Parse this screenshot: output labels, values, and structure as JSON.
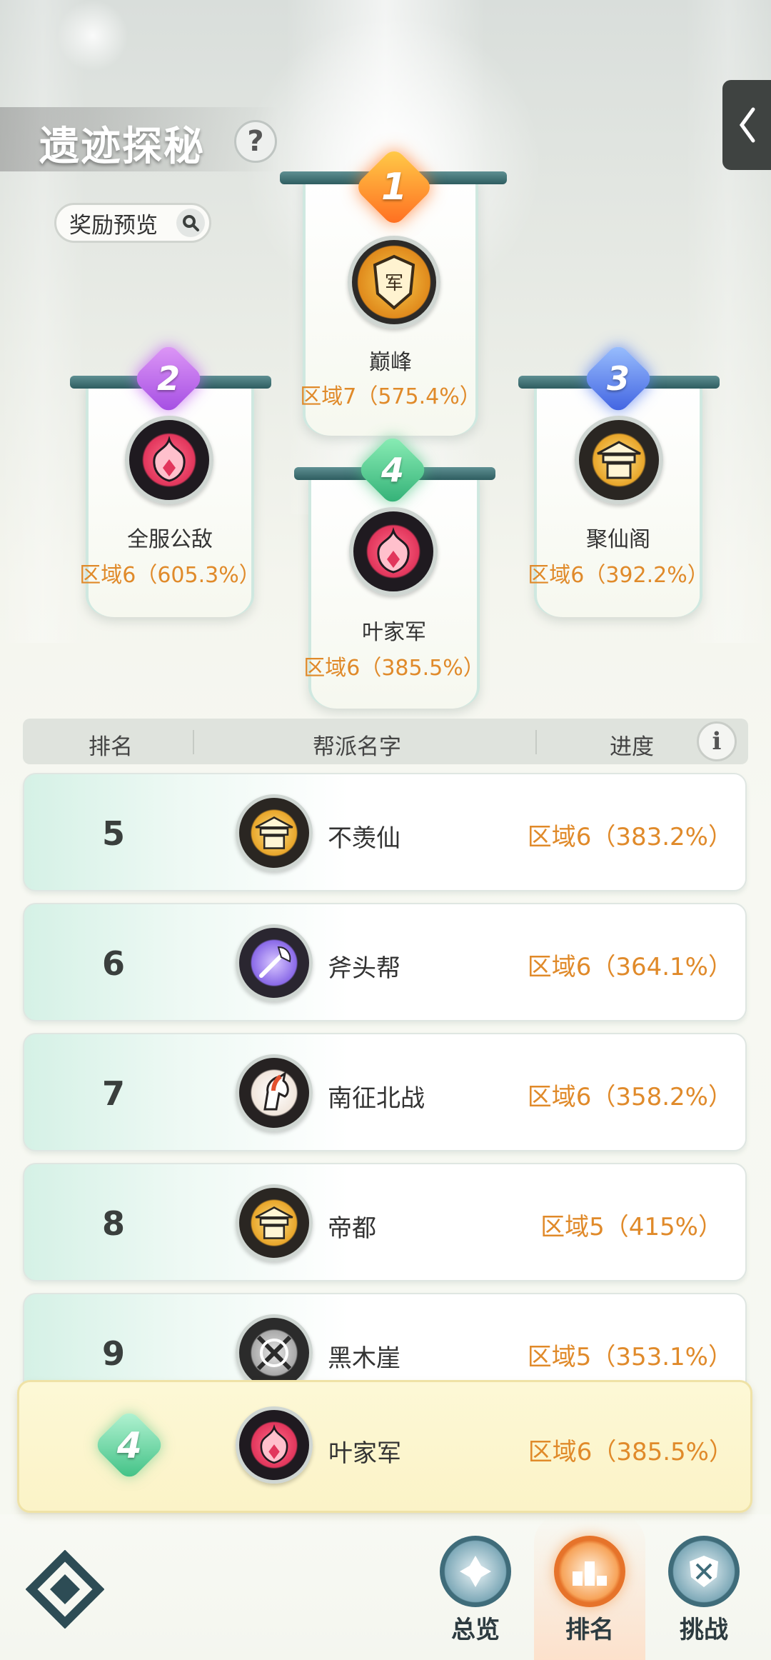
{
  "header": {
    "title": "遗迹探秘",
    "help_icon": "?",
    "reward_preview": "奖励预览"
  },
  "podium": [
    {
      "rank": "1",
      "name": "巅峰",
      "progress": "区域7（575.4%）",
      "badge_color": "#ff8a2a",
      "emblem": "army-shield-emblem"
    },
    {
      "rank": "2",
      "name": "全服公敌",
      "progress": "区域6（605.3%）",
      "badge_color": "#b05be6",
      "emblem": "crimson-flame-emblem"
    },
    {
      "rank": "3",
      "name": "聚仙阁",
      "progress": "区域6（392.2%）",
      "badge_color": "#4a6ee8",
      "emblem": "golden-pavilion-emblem"
    },
    {
      "rank": "4",
      "name": "叶家军",
      "progress": "区域6（385.5%）",
      "badge_color": "#3dbb7f",
      "emblem": "crimson-flame-emblem"
    }
  ],
  "table": {
    "headers": {
      "rank": "排名",
      "guild": "帮派名字",
      "progress": "进度",
      "info_icon": "i"
    },
    "rows": [
      {
        "rank": "5",
        "name": "不羡仙",
        "progress": "区域6（383.2%）",
        "emblem": "golden-pavilion-emblem"
      },
      {
        "rank": "6",
        "name": "斧头帮",
        "progress": "区域6（364.1%）",
        "emblem": "purple-axe-emblem"
      },
      {
        "rank": "7",
        "name": "南征北战",
        "progress": "区域6（358.2%）",
        "emblem": "warhorse-emblem"
      },
      {
        "rank": "8",
        "name": "帝都",
        "progress": "区域5（415%）",
        "emblem": "golden-pavilion-emblem"
      },
      {
        "rank": "9",
        "name": "黑木崖",
        "progress": "区域5（353.1%）",
        "emblem": "chain-emblem"
      }
    ]
  },
  "my_guild": {
    "rank": "4",
    "name": "叶家军",
    "progress": "区域6（385.5%）"
  },
  "bottom_nav": [
    {
      "label": "总览",
      "active": false
    },
    {
      "label": "排名",
      "active": true
    },
    {
      "label": "挑战",
      "active": false
    }
  ],
  "colors": {
    "progress_text": "#e08a2a",
    "accent_teal": "#2e5d60"
  }
}
